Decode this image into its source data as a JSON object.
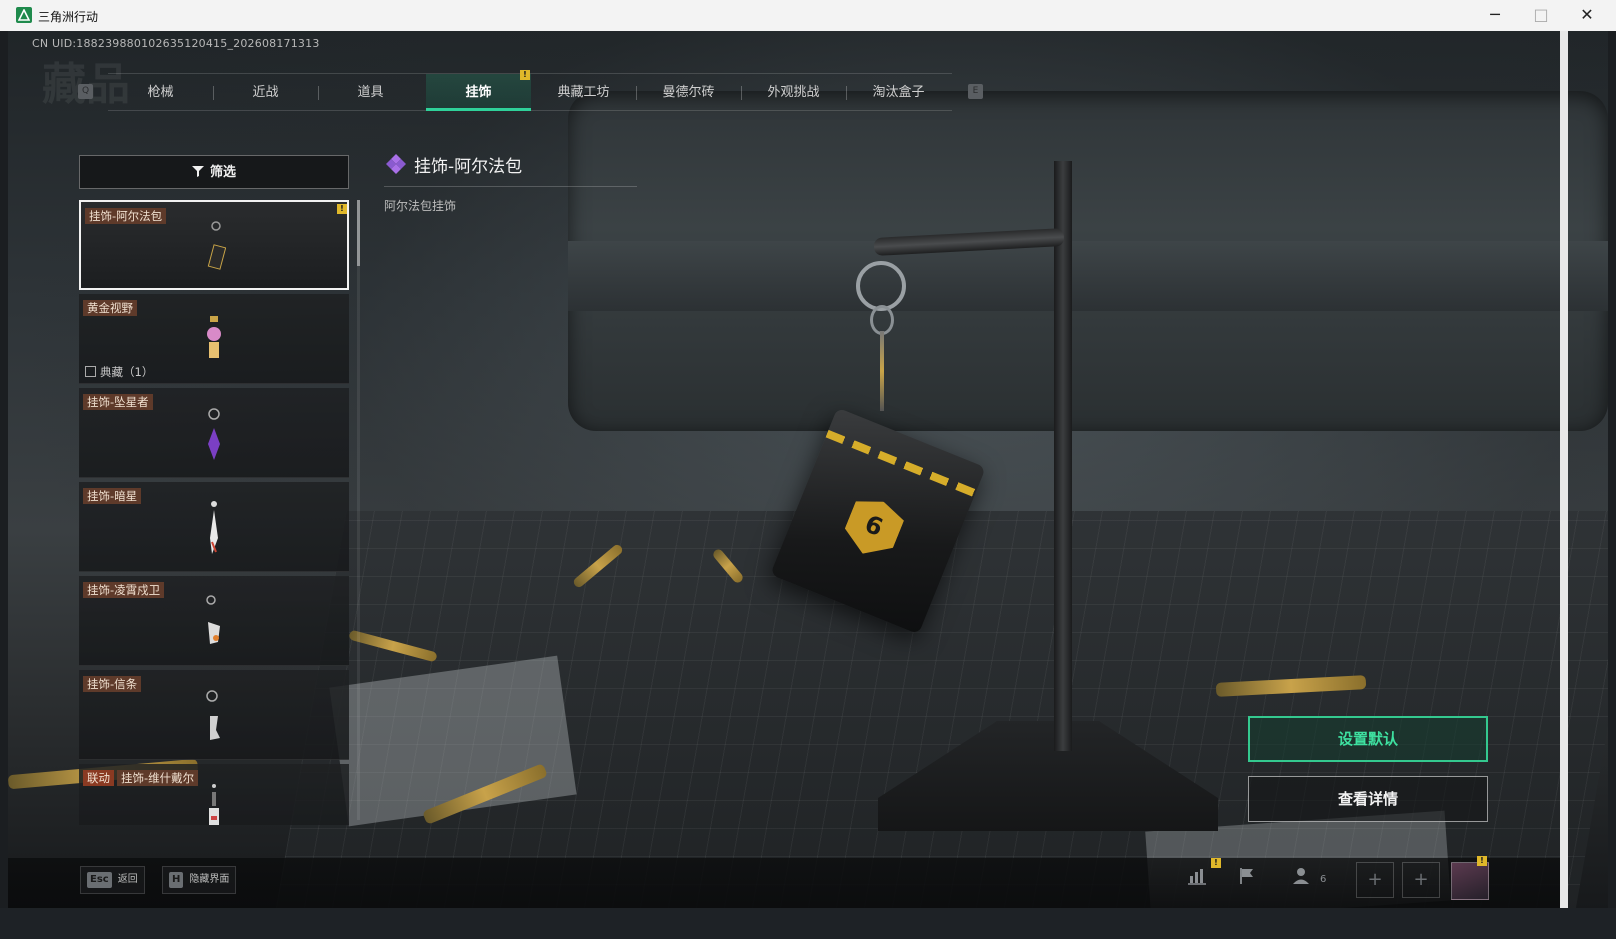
{
  "window": {
    "title": "三角洲行动",
    "minimize": "─",
    "maximize": "□",
    "close": "✕"
  },
  "account": {
    "uid": "CN UID:18823988010263512041​5_20260817131​3"
  },
  "page": {
    "watermark_title": "藏品"
  },
  "tabs": {
    "prev_key": "Q",
    "next_key": "E",
    "items": [
      {
        "label": "枪械"
      },
      {
        "label": "近战"
      },
      {
        "label": "道具"
      },
      {
        "label": "挂饰",
        "active": true,
        "notice": "!"
      },
      {
        "label": "典藏工坊"
      },
      {
        "label": "曼德尔砖"
      },
      {
        "label": "外观挑战"
      },
      {
        "label": "淘汰盒子"
      }
    ]
  },
  "filter": {
    "label": "筛选",
    "icon": "filter-icon"
  },
  "list": {
    "items": [
      {
        "name": "挂饰-阿尔法包",
        "selected": true,
        "notice": "!"
      },
      {
        "name": "黄金视野",
        "sub": "典藏（1）"
      },
      {
        "name": "挂饰-坠星者"
      },
      {
        "name": "挂饰-暗星"
      },
      {
        "name": "挂饰-凌霄戍卫"
      },
      {
        "name": "挂饰-信条"
      },
      {
        "collab": "联动",
        "name": "挂饰-维什戴尔"
      }
    ]
  },
  "detail": {
    "title": "挂饰-阿尔法包",
    "description": "阿尔法包挂饰",
    "badge_number": "6"
  },
  "actions": {
    "set_default": "设置默认",
    "view_details": "查看详情"
  },
  "bottom": {
    "esc_key": "Esc",
    "esc_label": "返回",
    "h_key": "H",
    "h_label": "隐藏界面",
    "party_count": "6",
    "slot_plus": "+"
  },
  "colors": {
    "accent": "#2fd19a",
    "notice": "#e0b82a",
    "tag_bg": "#5e3a2a"
  }
}
